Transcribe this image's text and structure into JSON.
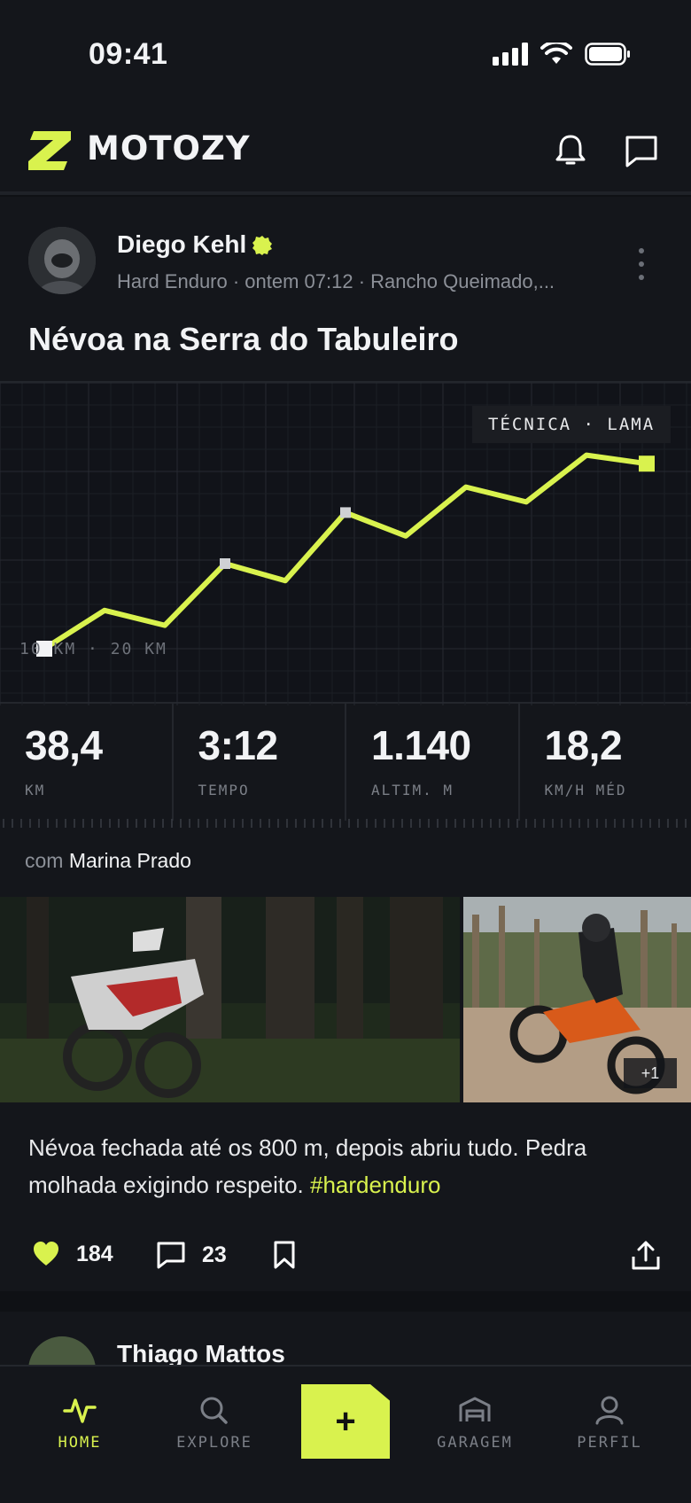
{
  "status_bar": {
    "time": "09:41"
  },
  "header": {
    "brand": "MOTOZY"
  },
  "post": {
    "author": "Diego Kehl",
    "meta": "Hard Enduro · ontem 07:12 · Rancho Queimado,...",
    "title": "Névoa na Serra do Tabuleiro",
    "chart_tag": "TÉCNICA · LAMA",
    "chart_scale": "10 KM · 20 KM",
    "stats": [
      {
        "value": "38,4",
        "label": "KM"
      },
      {
        "value": "3:12",
        "label": "TEMPO"
      },
      {
        "value": "1.140",
        "label": "ALTIM. M"
      },
      {
        "value": "18,2",
        "label": "KM/H MÉD"
      }
    ],
    "with_prefix": "com",
    "with_name": "Marina Prado",
    "more_photos": "+1",
    "caption_text": "Névoa fechada até os 800 m, depois abriu tudo. Pedra molhada exigindo respeito. ",
    "caption_hashtag": "#hardenduro",
    "likes": "184",
    "comments": "23"
  },
  "next_post": {
    "author": "Thiago Mattos"
  },
  "nav": {
    "items": [
      {
        "label": "HOME"
      },
      {
        "label": "EXPLORE"
      },
      {
        "label": "GARAGEM"
      },
      {
        "label": "PERFIL"
      }
    ],
    "fab": "+"
  },
  "colors": {
    "accent": "#d9f24e",
    "background": "#0f1115",
    "surface": "#14161b"
  },
  "chart_data": {
    "type": "line",
    "series": [
      {
        "values": [
          0,
          0.18,
          0.11,
          0.4,
          0.32,
          0.64,
          0.53,
          0.76,
          0.69,
          0.91,
          0.87
        ]
      }
    ],
    "markers": [
      0,
      3,
      5,
      10
    ]
  }
}
